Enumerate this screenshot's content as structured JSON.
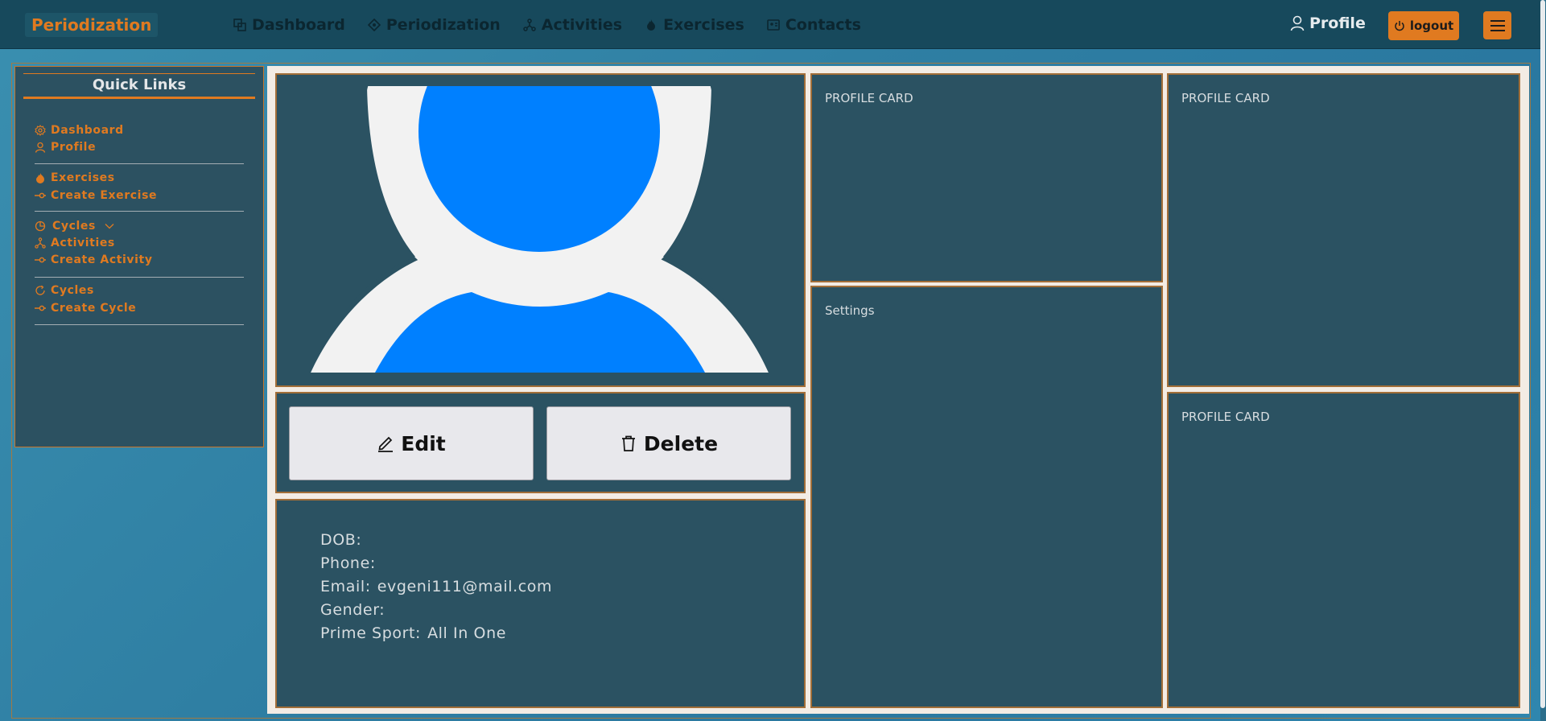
{
  "navbar": {
    "brand": "Periodization",
    "links": [
      {
        "label": "Dashboard",
        "icon": "dashboard-icon"
      },
      {
        "label": "Periodization",
        "icon": "periodization-icon"
      },
      {
        "label": "Activities",
        "icon": "activities-icon"
      },
      {
        "label": "Exercises",
        "icon": "fire-icon"
      },
      {
        "label": "Contacts",
        "icon": "contacts-icon"
      }
    ],
    "profile_label": "Profile",
    "logout_label": "logout"
  },
  "sidebar": {
    "title": "Quick Links",
    "groups": [
      [
        {
          "label": "Dashboard",
          "icon": "gear-icon"
        },
        {
          "label": "Profile",
          "icon": "person-icon"
        }
      ],
      [
        {
          "label": "Exercises",
          "icon": "fire-icon"
        },
        {
          "label": "Create Exercise",
          "icon": "commit-icon"
        }
      ],
      [
        {
          "label": "Cycles",
          "icon": "pie-chart-icon",
          "expandable": true
        },
        {
          "label": "Activities",
          "icon": "activities-icon"
        },
        {
          "label": "Create Activity",
          "icon": "commit-icon"
        }
      ],
      [
        {
          "label": "Cycles",
          "icon": "cycle-icon"
        },
        {
          "label": "Create Cycle",
          "icon": "commit-icon"
        }
      ]
    ]
  },
  "profile": {
    "edit_label": "Edit",
    "delete_label": "Delete",
    "fields": [
      {
        "label": "DOB:",
        "value": ""
      },
      {
        "label": "Phone:",
        "value": ""
      },
      {
        "label": "Email:",
        "value": "evgeni111@mail.com"
      },
      {
        "label": "Gender:",
        "value": ""
      },
      {
        "label": "Prime Sport:",
        "value": "All In One"
      }
    ]
  },
  "cards": {
    "card1": "PROFILE CARD",
    "settings": "Settings",
    "card2": "PROFILE CARD",
    "card3": "PROFILE CARD"
  },
  "colors": {
    "accent": "#e07a20",
    "navbar": "#17495c",
    "panel": "#2b5262",
    "avatar_blue": "#0080ff"
  }
}
